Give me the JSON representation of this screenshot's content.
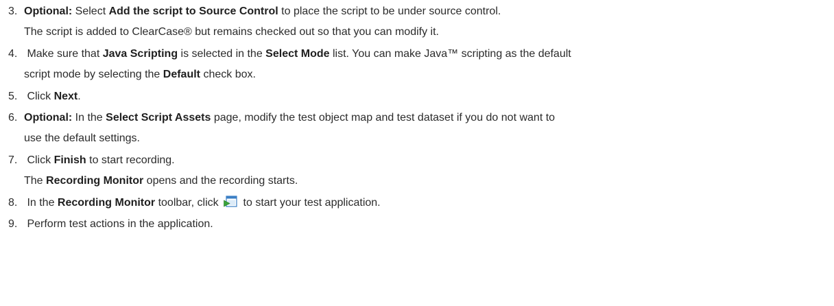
{
  "steps": [
    {
      "number": "3.",
      "optional": "Optional:",
      "t1": " Select ",
      "b1": "Add the script to Source Control",
      "t2": " to place the script to be under source control.",
      "note": "The script is added to ClearCase® but remains checked out so that you can modify it."
    },
    {
      "number": "4.",
      "t1": " Make sure that ",
      "b1": "Java Scripting",
      "t2": " is selected in the ",
      "b2": "Select Mode",
      "t3": " list. You can make Java™ scripting as the default",
      "l2_t1": "script mode by selecting the ",
      "l2_b1": "Default",
      "l2_t2": " check box."
    },
    {
      "number": "5.",
      "t1": " Click ",
      "b1": "Next",
      "t2": "."
    },
    {
      "number": "6.",
      "optional": "Optional:",
      "t1": " In the ",
      "b1": "Select Script Assets",
      "t2": " page, modify the test object map and test dataset if you do not want to",
      "l2_t1": "use the default settings."
    },
    {
      "number": "7.",
      "t1": " Click ",
      "b1": "Finish",
      "t2": " to start recording.",
      "note_t1": "The ",
      "note_b1": "Recording Monitor",
      "note_t2": " opens and the recording starts."
    },
    {
      "number": "8.",
      "t1": " In the ",
      "b1": "Recording Monitor",
      "t2": " toolbar, click ",
      "icon": "start-application-icon",
      "t3": " to start your test application."
    },
    {
      "number": "9.",
      "t1": " Perform test actions in the application."
    }
  ],
  "colors": {
    "text": "#2b2b2b",
    "icon_green": "#3aa33a",
    "icon_blue": "#3b7fc4"
  }
}
